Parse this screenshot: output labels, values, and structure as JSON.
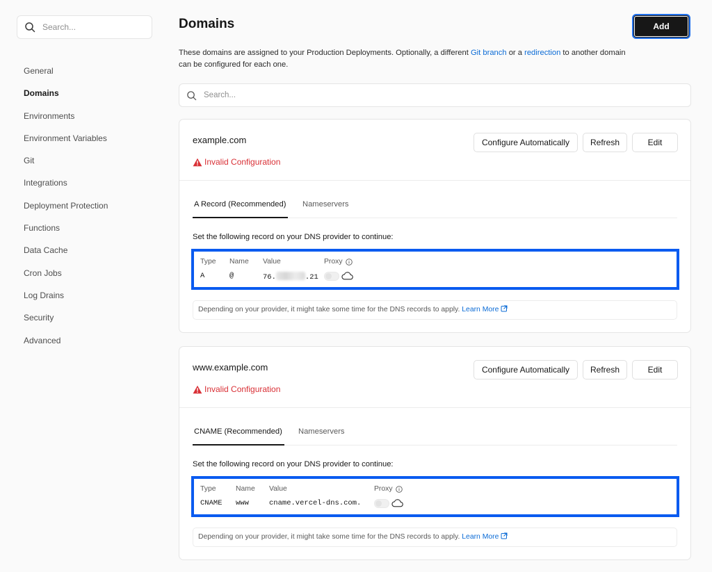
{
  "sidebar": {
    "search_placeholder": "Search...",
    "items": [
      {
        "label": "General"
      },
      {
        "label": "Domains",
        "active": true
      },
      {
        "label": "Environments"
      },
      {
        "label": "Environment Variables"
      },
      {
        "label": "Git"
      },
      {
        "label": "Integrations"
      },
      {
        "label": "Deployment Protection"
      },
      {
        "label": "Functions"
      },
      {
        "label": "Data Cache"
      },
      {
        "label": "Cron Jobs"
      },
      {
        "label": "Log Drains"
      },
      {
        "label": "Security"
      },
      {
        "label": "Advanced"
      }
    ]
  },
  "header": {
    "title": "Domains",
    "add_label": "Add"
  },
  "description": {
    "part1": "These domains are assigned to your Production Deployments. Optionally, a different ",
    "link1": "Git branch",
    "part2": " or a ",
    "link2": "redirection",
    "part3": " to another domain can be configured for each one."
  },
  "main_search": {
    "placeholder": "Search..."
  },
  "buttons": {
    "configure": "Configure Automatically",
    "refresh": "Refresh",
    "edit": "Edit"
  },
  "domains": [
    {
      "name": "example.com",
      "status": "Invalid Configuration",
      "tabs": [
        "A Record (Recommended)",
        "Nameservers"
      ],
      "instruction": "Set the following record on your DNS provider to continue:",
      "record": {
        "headers": {
          "type": "Type",
          "name": "Name",
          "value": "Value",
          "proxy": "Proxy"
        },
        "type": "A",
        "name": "@",
        "value_prefix": "76.",
        "value_suffix": ".21"
      },
      "note": "Depending on your provider, it might take some time for the DNS records to apply.",
      "note_link": "Learn More"
    },
    {
      "name": "www.example.com",
      "status": "Invalid Configuration",
      "tabs": [
        "CNAME (Recommended)",
        "Nameservers"
      ],
      "instruction": "Set the following record on your DNS provider to continue:",
      "record": {
        "headers": {
          "type": "Type",
          "name": "Name",
          "value": "Value",
          "proxy": "Proxy"
        },
        "type": "CNAME",
        "name": "www",
        "value": "cname.vercel-dns.com."
      },
      "note": "Depending on your provider, it might take some time for the DNS records to apply.",
      "note_link": "Learn More"
    }
  ],
  "colors": {
    "accent": "#0a5bf0",
    "link": "#0b6bd6",
    "error": "#d93036",
    "primary_button": "#171717"
  }
}
